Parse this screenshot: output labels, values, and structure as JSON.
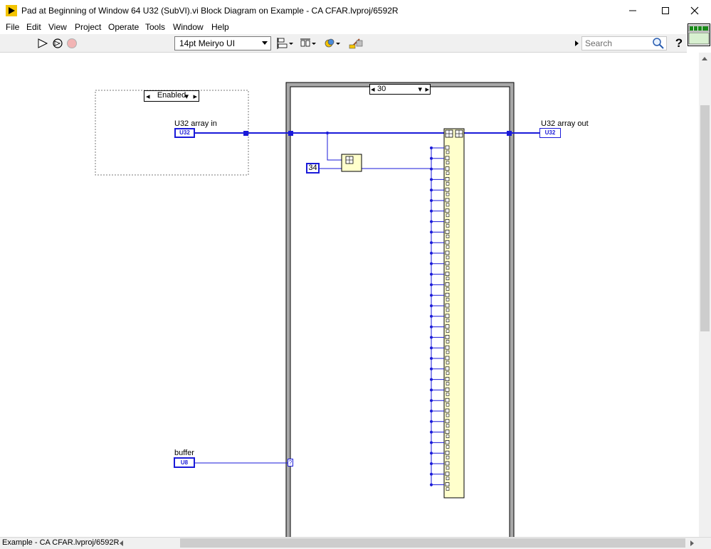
{
  "window": {
    "title": "Pad at Beginning of Window 64 U32 (SubVI).vi Block Diagram on Example - CA CFAR.lvproj/6592R"
  },
  "menu": {
    "items": [
      "File",
      "Edit",
      "View",
      "Project",
      "Operate",
      "Tools",
      "Window",
      "Help"
    ]
  },
  "toolbar": {
    "font_select_value": "14pt Meiryo UI",
    "search_placeholder": "Search",
    "help_glyph": "?"
  },
  "diagram": {
    "disable_structure_label": "Enabled",
    "case_selector_value": "30",
    "input_label": "U32 array in",
    "input_type": "U32",
    "output_label": "U32 array out",
    "output_type": "U32",
    "buffer_label": "buffer",
    "buffer_type": "U8",
    "constant_value": "34",
    "tunnel_glyph": "?"
  },
  "status": {
    "context": "Example - CA CFAR.lvproj/6592R"
  },
  "colors": {
    "wire_u32": "#1a1ad9",
    "node_fill": "#ffffcc",
    "case_frame": "#a8a8a8",
    "accent_icon": "#f4c400"
  }
}
